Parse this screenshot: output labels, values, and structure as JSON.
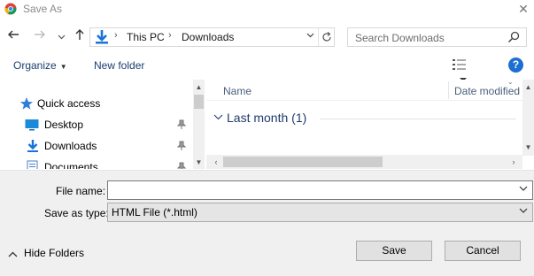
{
  "window": {
    "title": "Save As",
    "close_glyph": "✕"
  },
  "nav": {
    "back_icon": "arrow-left-icon",
    "forward_icon": "arrow-right-icon",
    "recent_icon": "chevron-down-icon",
    "up_icon": "arrow-up-icon",
    "breadcrumb": [
      "This PC",
      "Downloads"
    ],
    "refresh_icon": "refresh-icon"
  },
  "search": {
    "placeholder": "Search Downloads"
  },
  "toolbar": {
    "organize_label": "Organize",
    "new_folder_label": "New folder",
    "help_label": "?"
  },
  "navpane": {
    "items": [
      {
        "label": "Quick access",
        "icon": "star-icon",
        "pinned": false
      },
      {
        "label": "Desktop",
        "icon": "desktop-icon",
        "pinned": true
      },
      {
        "label": "Downloads",
        "icon": "download-icon",
        "pinned": true
      },
      {
        "label": "Documents",
        "icon": "document-icon",
        "pinned": true
      }
    ]
  },
  "files": {
    "columns": [
      "Name",
      "Date modified"
    ],
    "groups": [
      {
        "label": "Last month (1)"
      }
    ]
  },
  "form": {
    "file_name_label": "File name:",
    "file_name_value": "",
    "save_as_type_label": "Save as type:",
    "save_as_type_value": "HTML File (*.html)"
  },
  "footer": {
    "hide_folders_label": "Hide Folders",
    "save_label": "Save",
    "cancel_label": "Cancel"
  },
  "colors": {
    "accent": "#1c6fd1",
    "link": "#1a3e72",
    "group_header": "#1e3b6e",
    "dialog_bg": "#f0f0f0"
  }
}
